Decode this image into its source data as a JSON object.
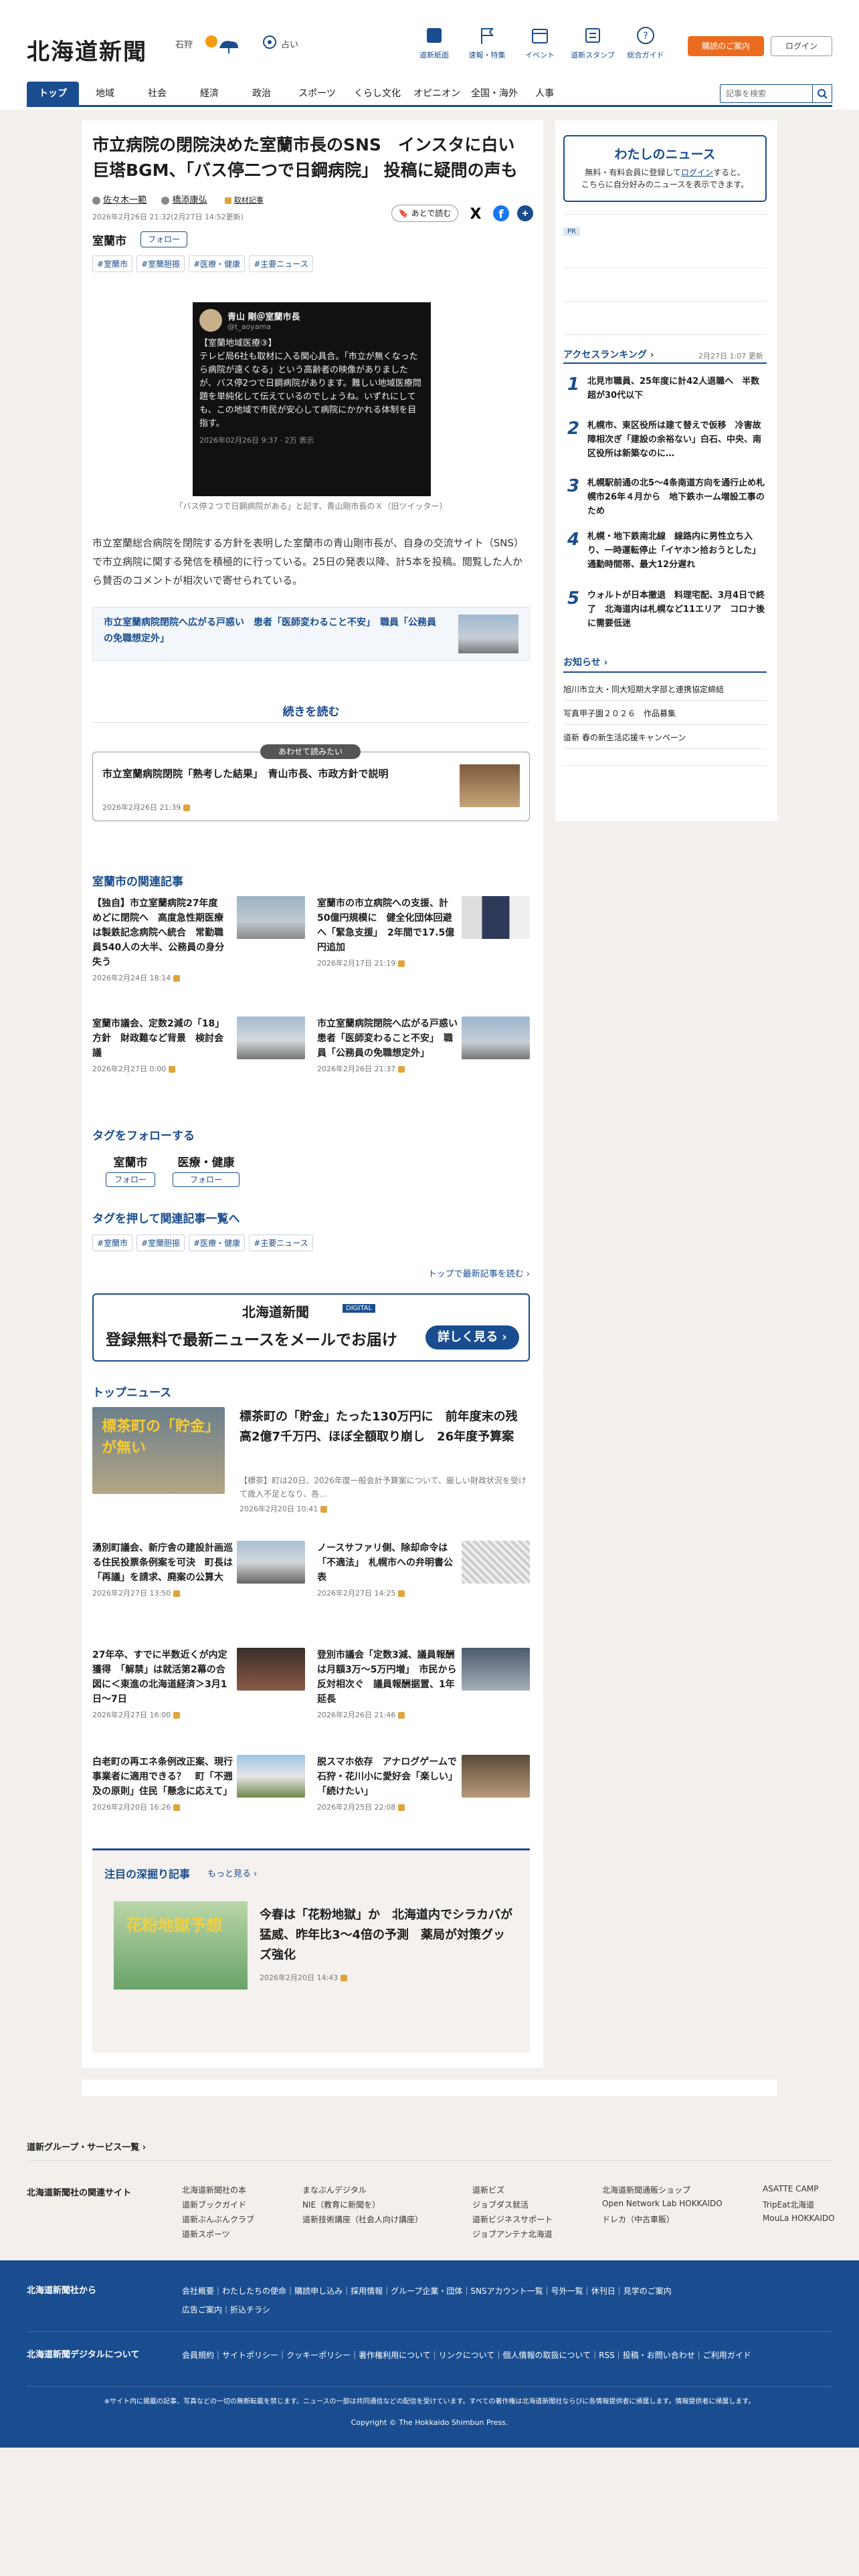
{
  "header": {
    "logo": "北海道新聞",
    "weather_city": "石狩",
    "fortune": "占い",
    "tools": [
      {
        "label": "道新紙面",
        "icon": "newspaper-icon"
      },
      {
        "label": "速報・特集",
        "icon": "flag-icon"
      },
      {
        "label": "イベント",
        "icon": "calendar-icon"
      },
      {
        "label": "道新スタンプ",
        "icon": "stamp-icon"
      },
      {
        "label": "総合ガイド",
        "icon": "question-icon"
      }
    ],
    "subscribe": "購読のご案内",
    "login": "ログイン",
    "search_placeholder": "記事を検索"
  },
  "nav": [
    "トップ",
    "地域",
    "社会",
    "経済",
    "政治",
    "スポーツ",
    "くらし文化",
    "オピニオン",
    "全国・海外",
    "人事"
  ],
  "article": {
    "title": "市立病院の閉院決めた室蘭市長のSNS　インスタに白い巨塔BGM、「バス停二つで日鋼病院」 投稿に疑問の声も",
    "author1": "佐々木一範",
    "author2": "橋添康弘",
    "related_label": "取材記事",
    "date": "2026年2月26日 21:32(2月27日 14:52更新)",
    "save": "あとで読む",
    "region": "室蘭市",
    "follow": "フォロー",
    "tags": [
      "#室蘭市",
      "#室蘭胆振",
      "#医療・健康",
      "#主要ニュース"
    ],
    "sns_name": "青山 剛＠室蘭市長",
    "sns_handle": "@t_aoyama",
    "sns_body": "【室蘭地域医療③】\nテレビ局6社も取材に入る関心具合。「市立が無くなったら病院が遠くなる」という高齢者の映像がありましたが、バス停2つで日鋼病院があります。難しい地域医療問題を単純化して伝えているのでしょうね。いずれにしても、この地域で市民が安心して病院にかかれる体制を目指す。",
    "sns_date": "2026年02月26日 9:37 · 2万 表示",
    "caption": "「バス停２つで日鋼病院がある」と記す、青山剛市長のＸ（旧ツイッター）",
    "lead": "市立室蘭総合病院を閉院する方針を表明した室蘭市の青山剛市長が、自身の交流サイト（SNS）で市立病院に関する発信を積極的に行っている。25日の発表以降、計5本を投稿。閲覧した人から賛否のコメントが相次いで寄せられている。",
    "related_link": "市立室蘭病院閉院へ広がる戸惑い　患者「医師変わること不安」　職員「公務員の免職想定外」",
    "readmore": "続きを読む",
    "also_label": "あわせて読みたい",
    "also_title": "市立室蘭病院閉院「熟考した結果」　青山市長、市政方針で説明",
    "also_date": "2026年2月26日 21:39"
  },
  "related": {
    "heading": "室蘭市の関連記事",
    "items": [
      {
        "title": "【独自】市立室蘭病院27年度めどに閉院へ　高度急性期医療は製鉄記念病院へ統合　常勤職員540人の大半、公務員の身分失う",
        "date": "2026年2月24日 18:14"
      },
      {
        "title": "室蘭市の市立病院への支援、計50億円規模に　健全化団体回避へ「緊急支援」　2年間で17.5億円追加",
        "date": "2026年2月17日 21:19"
      },
      {
        "title": "室蘭市議会、定数2減の「18」方針　財政難など背景　検討会議",
        "date": "2026年2月27日 0:00"
      },
      {
        "title": "市立室蘭病院閉院へ広がる戸惑い　患者「医師変わること不安」　職員「公務員の免職想定外」",
        "date": "2026年2月26日 21:37"
      }
    ]
  },
  "follow_tags": {
    "heading": "タグをフォローする",
    "items": [
      {
        "name": "室蘭市",
        "btn": "フォロー"
      },
      {
        "name": "医療・健康",
        "btn": "フォロー"
      }
    ]
  },
  "tag_list": {
    "heading": "タグを押して関連記事一覧へ",
    "tags": [
      "#室蘭市",
      "#室蘭胆振",
      "#医療・健康",
      "#主要ニュース"
    ],
    "more": "トップで最新記事を読む"
  },
  "banner": {
    "brand": "北海道新聞",
    "sub": "DIGITAL",
    "text": "登録無料で最新ニュースをメールでお届け",
    "cta": "詳しく見る"
  },
  "top_news": {
    "heading": "トップニュース",
    "lead_title": "標茶町の「貯金」たった130万円に　前年度末の残高2億7千万円、ほぼ全額取り崩し　26年度予算案",
    "lead_body": "【標茶】町は20日、2026年度一般会計予算案について、厳しい財政状況を受けて歳入不足となり、各...",
    "lead_date": "2026年2月20日 10:41",
    "lead_thumb_text": "標茶町の「貯金」が無い",
    "items": [
      {
        "title": "湧別町議会、新庁舎の建設計画巡る住民投票条例案を可決　町長は「再議」を請求、廃案の公算大",
        "date": "2026年2月27日 13:50"
      },
      {
        "title": "ノースサファリ側、除却命令は「不適法」　札幌市への弁明書公表",
        "date": "2026年2月27日 14:25"
      },
      {
        "title": "27年卒、すでに半数近くが内定獲得　「解禁」は就活第2幕の合図に＜東進の北海道経済＞3月1日〜7日",
        "date": "2026年2月27日 16:00"
      },
      {
        "title": "登別市議会「定数3減、議員報酬は月額3万〜5万円増」　市民から反対相次ぐ　議員報酬据置、1年延長",
        "date": "2026年2月26日 21:46"
      },
      {
        "title": "白老町の再エネ条例改正案、現行事業者に適用できる？　町「不遡及の原則」住民「懸念に応えて」",
        "date": "2026年2月20日 16:26"
      },
      {
        "title": "脱スマホ依存　アナログゲームで　石狩・花川小に愛好会「楽しい」「続けたい」",
        "date": "2026年2月25日 22:08"
      }
    ]
  },
  "deep": {
    "heading": "注目の深掘り記事",
    "more": "もっと見る",
    "title": "今春は「花粉地獄」か　北海道内でシラカバが猛威、昨年比3〜4倍の予測　薬局が対策グッズ強化",
    "date": "2026年2月20日 14:43",
    "thumb_text": "花粉地獄予想"
  },
  "side": {
    "mynews_title": "わたしのニュース",
    "mynews_body1": "無料・有料会員に登録して",
    "mynews_login": "ログイン",
    "mynews_body2": "すると、",
    "mynews_body3": "こちらに自分好みのニュースを表示できます。",
    "pr": "PR",
    "ranking_title": "アクセスランキング",
    "ranking_date": "2月27日 1:07 更新",
    "ranking": [
      {
        "n": "1",
        "t": "北見市職員、25年度に計42人退職へ　半数超が30代以下"
      },
      {
        "n": "2",
        "t": "札幌市、東区役所は建て替えで仮移　冷害故障相次ぎ「建設の余裕ない」白石、中央、南区役所は新築なのに…"
      },
      {
        "n": "3",
        "t": "札幌駅前通の北5〜4条南道方向を通行止め札幌市26年４月から　地下鉄ホーム増設工事のため"
      },
      {
        "n": "4",
        "t": "札幌・地下鉄南北線　線路内に男性立ち入り、一時運転停止「イヤホン拾おうとした」通勤時間帯、最大12分遅れ"
      },
      {
        "n": "5",
        "t": "ウォルトが日本撤退　料理宅配、3月4日で終了　北海道内は札幌など11エリア　コロナ後に需要低迷"
      }
    ],
    "notice_title": "お知らせ",
    "notices": [
      "旭川市立大・同大短期大学部と連携協定締結",
      "写真甲子園２０２６　作品募集",
      "道新 春の新生活応援キャンペーン"
    ]
  },
  "footer": {
    "group_title": "道新グループ・サービス一覧",
    "sites_title": "北海道新聞社の関連サイト",
    "sites": [
      "北海道新聞社の本",
      "道新ブックガイド",
      "道新ぶんぶんクラブ",
      "道新スポーツ",
      "まなぶんデジタル",
      "NIE（教育に新聞を）",
      "道新技術講座（社会人向け講座）",
      "道新ビズ",
      "ジョブダス就活",
      "道新ビジネスサポート",
      "ジョブアンテナ北海道",
      "北海道新聞通販ショップ",
      "Open Network Lab HOKKAIDO",
      "ドレカ（中古車販）",
      "ASATTE CAMP",
      "TripEat北海道",
      "MouLa HOKKAIDO"
    ],
    "about_title": "北海道新聞社から",
    "about_links": [
      "会社概要",
      "わたしたちの使命",
      "購読申し込み",
      "採用情報",
      "グループ企業・団体",
      "SNSアカウント一覧",
      "号外一覧",
      "休刊日",
      "見学のご案内",
      "広告ご案内",
      "折込チラシ"
    ],
    "digital_title": "北海道新聞デジタルについて",
    "digital_links": [
      "会員規約",
      "サイトポリシー",
      "クッキーポリシー",
      "著作権利用について",
      "リンクについて",
      "個人情報の取扱について",
      "RSS",
      "投稿・お問い合わせ",
      "ご利用ガイド"
    ],
    "notice": "※サイト内に掲載の記事、写真などの一切の無断転載を禁じます。ニュースの一部は共同通信などの配信を受けています。すべての著作権は北海道新聞社ならびに各情報提供者に帰属します。情報提供者に帰属します。",
    "copyright": "Copyright © The Hokkaido Shimbun Press."
  }
}
